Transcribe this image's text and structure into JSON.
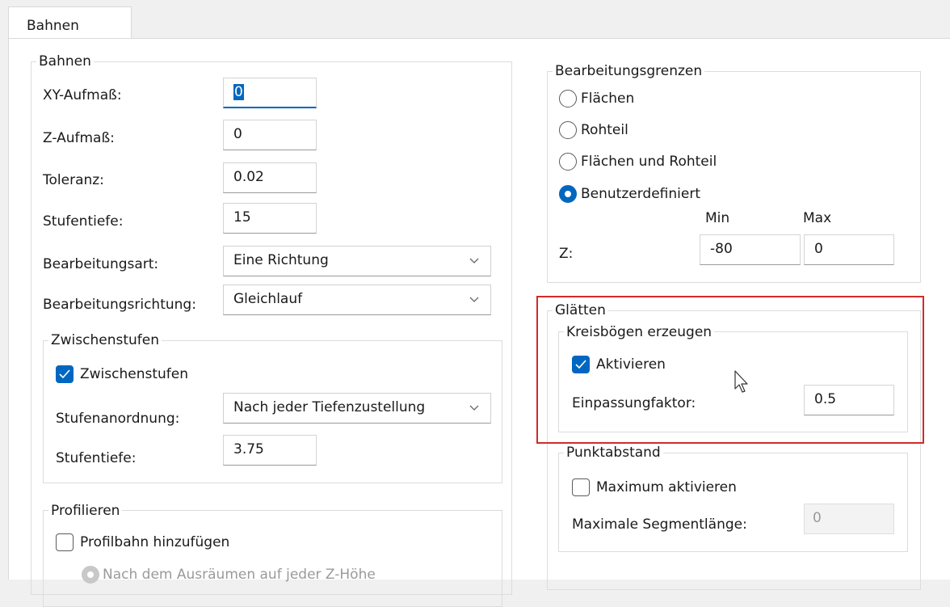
{
  "tab": {
    "label": "Bahnen"
  },
  "bahnen": {
    "title": "Bahnen",
    "xy_label": "XY-Aufmaß:",
    "xy_value": "0",
    "z_label": "Z-Aufmaß:",
    "z_value": "0",
    "tol_label": "Toleranz:",
    "tol_value": "0.02",
    "stufentiefe_label": "Stufentiefe:",
    "stufentiefe_value": "15",
    "art_label": "Bearbeitungsart:",
    "art_value": "Eine Richtung",
    "richtung_label": "Bearbeitungsrichtung:",
    "richtung_value": "Gleichlauf"
  },
  "zwischenstufen": {
    "title": "Zwischenstufen",
    "check_label": "Zwischenstufen",
    "checked": true,
    "anordnung_label": "Stufenanordnung:",
    "anordnung_value": "Nach jeder Tiefenzustellung",
    "stufentiefe_label": "Stufentiefe:",
    "stufentiefe_value": "3.75"
  },
  "profilieren": {
    "title": "Profilieren",
    "check_label": "Profilbahn hinzufügen",
    "checked": false,
    "radio_label": "Nach dem Ausräumen auf jeder Z-Höhe"
  },
  "grenzen": {
    "title": "Bearbeitungsgrenzen",
    "options": [
      "Flächen",
      "Rohteil",
      "Flächen und Rohteil",
      "Benutzerdefiniert"
    ],
    "selected": "Benutzerdefiniert",
    "min_label": "Min",
    "max_label": "Max",
    "z_label": "Z:",
    "z_min": "-80",
    "z_max": "0"
  },
  "glaetten": {
    "title": "Glätten",
    "kreis_title": "Kreisbögen erzeugen",
    "aktivieren_label": "Aktivieren",
    "aktivieren_checked": true,
    "faktor_label": "Einpassungfaktor:",
    "faktor_value": "0.5",
    "punkt_title": "Punktabstand",
    "max_label": "Maximum aktivieren",
    "max_checked": false,
    "segment_label": "Maximale Segmentlänge:",
    "segment_value": "0"
  },
  "colors": {
    "accent": "#0067c0",
    "highlight_box": "#d22b2b"
  }
}
